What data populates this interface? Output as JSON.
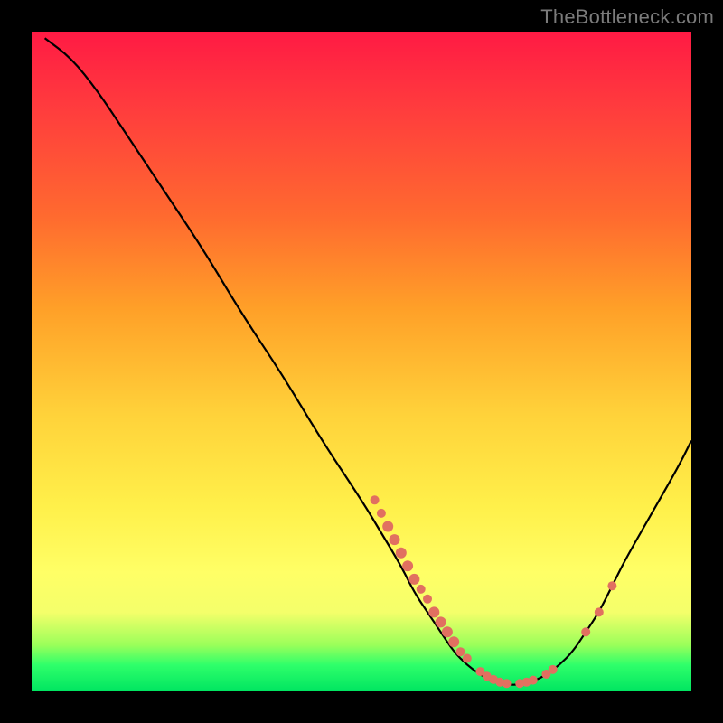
{
  "watermark": "TheBottleneck.com",
  "chart_data": {
    "type": "line",
    "title": "",
    "xlabel": "",
    "ylabel": "",
    "xlim": [
      0,
      100
    ],
    "ylim": [
      0,
      100
    ],
    "background_gradient": {
      "top": "#ff1a44",
      "bottom": "#00e561"
    },
    "curve": [
      {
        "x": 2,
        "y": 99
      },
      {
        "x": 6,
        "y": 96
      },
      {
        "x": 10,
        "y": 91
      },
      {
        "x": 14,
        "y": 85
      },
      {
        "x": 20,
        "y": 76
      },
      {
        "x": 26,
        "y": 67
      },
      {
        "x": 32,
        "y": 57
      },
      {
        "x": 38,
        "y": 48
      },
      {
        "x": 44,
        "y": 38
      },
      {
        "x": 50,
        "y": 29
      },
      {
        "x": 53,
        "y": 24
      },
      {
        "x": 56,
        "y": 19
      },
      {
        "x": 58,
        "y": 15
      },
      {
        "x": 60,
        "y": 12
      },
      {
        "x": 62,
        "y": 9
      },
      {
        "x": 64,
        "y": 6
      },
      {
        "x": 66,
        "y": 4
      },
      {
        "x": 68,
        "y": 2.5
      },
      {
        "x": 70,
        "y": 1.5
      },
      {
        "x": 72,
        "y": 1
      },
      {
        "x": 74,
        "y": 1
      },
      {
        "x": 76,
        "y": 1.5
      },
      {
        "x": 78,
        "y": 2.5
      },
      {
        "x": 80,
        "y": 4
      },
      {
        "x": 82,
        "y": 6
      },
      {
        "x": 84,
        "y": 9
      },
      {
        "x": 86,
        "y": 12
      },
      {
        "x": 88,
        "y": 16
      },
      {
        "x": 90,
        "y": 20
      },
      {
        "x": 94,
        "y": 27
      },
      {
        "x": 98,
        "y": 34
      },
      {
        "x": 100,
        "y": 38
      }
    ],
    "dots": [
      {
        "x": 52,
        "y": 29,
        "r": 5
      },
      {
        "x": 53,
        "y": 27,
        "r": 5
      },
      {
        "x": 54,
        "y": 25,
        "r": 6
      },
      {
        "x": 55,
        "y": 23,
        "r": 6
      },
      {
        "x": 56,
        "y": 21,
        "r": 6
      },
      {
        "x": 57,
        "y": 19,
        "r": 6
      },
      {
        "x": 58,
        "y": 17,
        "r": 6
      },
      {
        "x": 59,
        "y": 15.5,
        "r": 5
      },
      {
        "x": 60,
        "y": 14,
        "r": 5
      },
      {
        "x": 61,
        "y": 12,
        "r": 6
      },
      {
        "x": 62,
        "y": 10.5,
        "r": 6
      },
      {
        "x": 63,
        "y": 9,
        "r": 6
      },
      {
        "x": 64,
        "y": 7.5,
        "r": 6
      },
      {
        "x": 65,
        "y": 6,
        "r": 5
      },
      {
        "x": 66,
        "y": 5,
        "r": 5
      },
      {
        "x": 68,
        "y": 3,
        "r": 5
      },
      {
        "x": 69,
        "y": 2.3,
        "r": 5
      },
      {
        "x": 70,
        "y": 1.8,
        "r": 5
      },
      {
        "x": 71,
        "y": 1.4,
        "r": 5
      },
      {
        "x": 72,
        "y": 1.2,
        "r": 5
      },
      {
        "x": 74,
        "y": 1.2,
        "r": 5
      },
      {
        "x": 75,
        "y": 1.4,
        "r": 5
      },
      {
        "x": 76,
        "y": 1.7,
        "r": 5
      },
      {
        "x": 78,
        "y": 2.6,
        "r": 5
      },
      {
        "x": 79,
        "y": 3.3,
        "r": 5
      },
      {
        "x": 84,
        "y": 9,
        "r": 5
      },
      {
        "x": 86,
        "y": 12,
        "r": 5
      },
      {
        "x": 88,
        "y": 16,
        "r": 5
      }
    ]
  }
}
